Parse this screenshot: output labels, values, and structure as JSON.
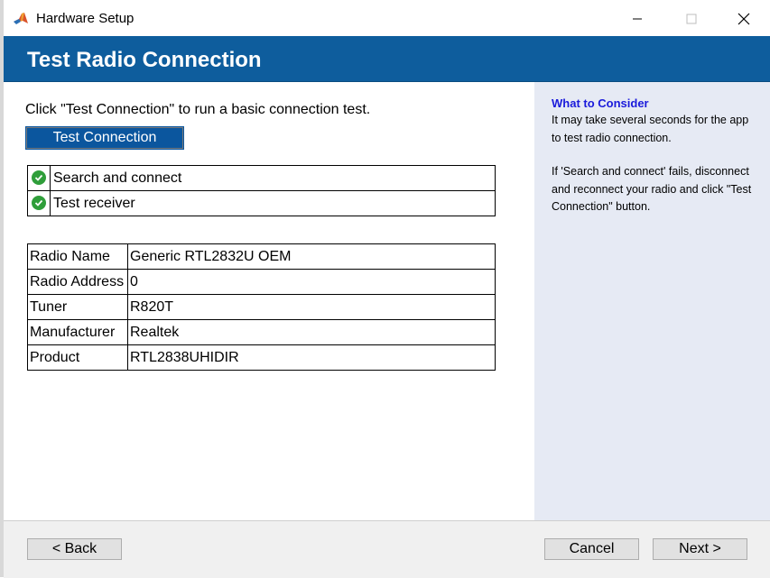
{
  "window": {
    "title": "Hardware Setup",
    "app_icon": "matlab-icon"
  },
  "header": {
    "title": "Test Radio Connection"
  },
  "main": {
    "instruction": "Click \"Test Connection\" to run a basic connection test.",
    "test_button_label": "Test Connection",
    "status_items": [
      {
        "icon": "check-circle-icon",
        "label": "Search and connect"
      },
      {
        "icon": "check-circle-icon",
        "label": "Test receiver"
      }
    ],
    "info_rows": [
      {
        "key": "Radio Name",
        "value": "Generic RTL2832U OEM"
      },
      {
        "key": "Radio Address",
        "value": "0"
      },
      {
        "key": "Tuner",
        "value": "R820T"
      },
      {
        "key": "Manufacturer",
        "value": "Realtek"
      },
      {
        "key": "Product",
        "value": "RTL2838UHIDIR"
      }
    ]
  },
  "side_panel": {
    "title": "What to Consider",
    "paragraph1": "It may take several seconds for the app to test radio connection.",
    "paragraph2": "If 'Search and connect' fails, disconnect and reconnect your radio and click \"Test Connection\" button."
  },
  "footer": {
    "back_label": "< Back",
    "cancel_label": "Cancel",
    "next_label": "Next >"
  },
  "colors": {
    "banner": "#0e5d9d",
    "side_panel": "#e6eaf4",
    "side_title": "#1a1adb",
    "check": "#2f9e3a"
  }
}
